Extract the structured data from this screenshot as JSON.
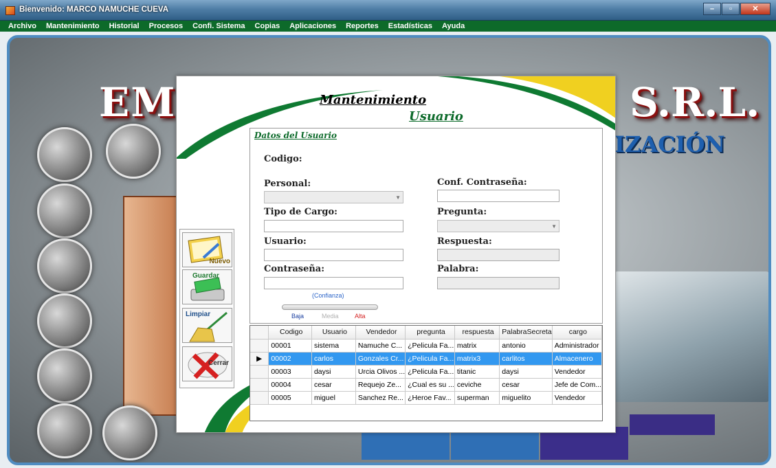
{
  "window": {
    "title": "Bienvenido: MARCO NAMUCHE CUEVA"
  },
  "menu": [
    "Archivo",
    "Mantenimiento",
    "Historial",
    "Procesos",
    "Confi. Sistema",
    "Copias",
    "Aplicaciones",
    "Reportes",
    "Estadísticas",
    "Ayuda"
  ],
  "background": {
    "title_left": "EMI",
    "title_right": "S.R.L.",
    "subtitle": "IZACIÓN"
  },
  "dialog": {
    "heading1": "Mantenimiento",
    "heading2": "Usuario",
    "group_title": "Datos del Usuario",
    "labels": {
      "codigo": "Codigo:",
      "personal": "Personal:",
      "tipo_cargo": "Tipo de Cargo:",
      "usuario": "Usuario:",
      "contrasena": "Contraseña:",
      "conf_contrasena": "Conf. Contraseña:",
      "pregunta": "Pregunta:",
      "respuesta": "Respuesta:",
      "palabra": "Palabra:"
    },
    "strength": {
      "confianza": "(Confianza)",
      "baja": "Baja",
      "media": "Media",
      "alta": "Alta"
    },
    "buttons": {
      "nuevo": "Nuevo",
      "guardar": "Guardar",
      "limpiar": "Limpiar",
      "cerrar": "Cerrar"
    },
    "colors": {
      "accent_green": "#0c6a2a",
      "selection": "#3298f0"
    }
  },
  "grid": {
    "columns": [
      "Codigo",
      "Usuario",
      "Vendedor",
      "pregunta",
      "respuesta",
      "PalabraSecreta",
      "cargo"
    ],
    "rows": [
      [
        "00001",
        "sistema",
        "Namuche C...",
        "¿Pelicula Fa...",
        "matrix",
        "antonio",
        "Administrador"
      ],
      [
        "00002",
        "carlos",
        "Gonzales Cr...",
        "¿Pelicula Fa...",
        "matrix3",
        "carlitos",
        "Almacenero"
      ],
      [
        "00003",
        "daysi",
        "Urcia Olivos ...",
        "¿Pelicula Fa...",
        "titanic",
        "daysi",
        "Vendedor"
      ],
      [
        "00004",
        "cesar",
        "Requejo Ze...",
        "¿Cual es su ...",
        "ceviche",
        "cesar",
        "Jefe de Com..."
      ],
      [
        "00005",
        "miguel",
        "Sanchez Re...",
        "¿Heroe Fav...",
        "superman",
        "miguelito",
        "Vendedor"
      ]
    ],
    "selected_row": 1
  }
}
